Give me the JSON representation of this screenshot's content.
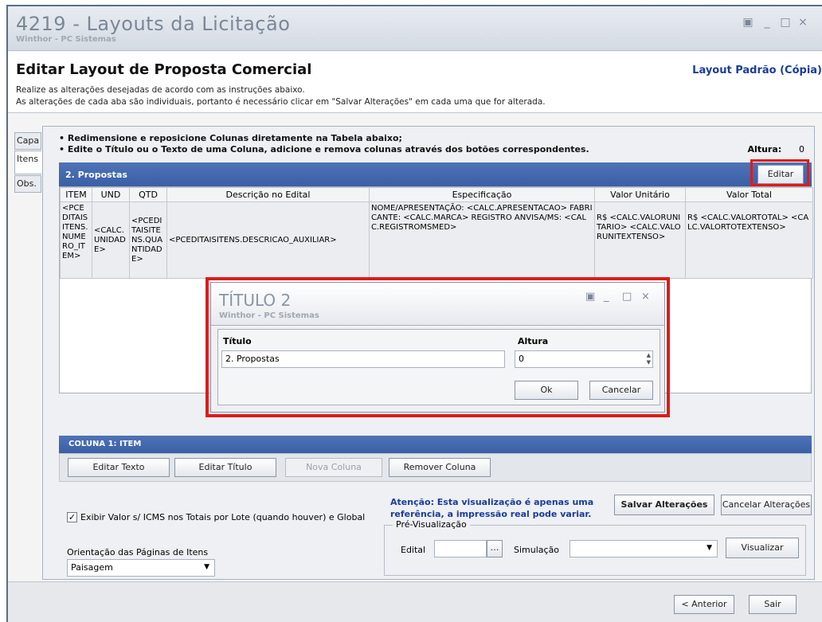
{
  "window": {
    "title": "4219 - Layouts da Licitação",
    "subtitle": "Winthor - PC Sistemas",
    "controls": [
      "▣",
      "_",
      "□",
      "×"
    ]
  },
  "header": {
    "title": "Editar Layout de Proposta Comercial",
    "layout_name": "Layout Padrão (Cópia)",
    "desc1": "Realize as alterações desejadas de acordo com as instruções abaixo.",
    "desc2": "As alterações de cada aba são individuais, portanto é necessário clicar em \"Salvar Alterações\" em cada uma que for alterada."
  },
  "sidetabs": [
    "Capa",
    "Itens",
    "Obs."
  ],
  "instructions": {
    "line1": "• Redimensione e reposicione Colunas diretamente na Tabela abaixo;",
    "line2": "• Edite o Título ou o Texto de uma Coluna, adicione e remova colunas  através dos botões correspondentes.",
    "altura_label": "Altura:",
    "altura_value": "0"
  },
  "section": {
    "title": "2. Propostas",
    "edit_button": "Editar"
  },
  "table": {
    "headers": [
      "ITEM",
      "UND",
      "QTD",
      "Descrição no Edital",
      "Especificação",
      "Valor Unitário",
      "Valor Total"
    ],
    "row": [
      "<PCEDITAISITENS.NUMERO_ITEM>",
      "<CALC.UNIDADE>",
      "<PCEDITAISITENS.QUANTIDADE>",
      "<PCEDITAISITENS.DESCRICAO_AUXILIAR>",
      "NOME/APRESENTAÇÃO: <CALC.APRESENTACAO> FABRICANTE: <CALC.MARCA> REGISTRO ANVISA/MS: <CALC.REGISTROMSMED>",
      "R$ <CALC.VALORUNITARIO> <CALC.VALORUNITEXTENSO>",
      "R$ <CALC.VALORTOTAL> <CALC.VALORTOTEXTENSO>"
    ]
  },
  "column_bar": "COLUNA 1: ITEM",
  "buttons": {
    "editar_texto": "Editar Texto",
    "editar_titulo": "Editar Título",
    "nova_coluna": "Nova Coluna",
    "remover_coluna": "Remover Coluna",
    "salvar": "Salvar Alterações",
    "cancelar_alteracoes": "Cancelar Alterações",
    "visualizar": "Visualizar",
    "anterior": "< Anterior",
    "sair": "Sair"
  },
  "checkbox": {
    "checked": true,
    "label": "Exibir Valor s/ ICMS nos Totais por Lote (quando houver) e Global"
  },
  "atencao": {
    "line1": "Atenção: Esta visualização é apenas uma",
    "line2": "referência, a impressão real pode variar."
  },
  "orientacao": {
    "label": "Orientação das Páginas de Itens",
    "value": "Paisagem"
  },
  "preview": {
    "legend": "Pré-Visualização",
    "edital_label": "Edital",
    "edital_value": "",
    "simulacao_label": "Simulação",
    "simulacao_value": ""
  },
  "modal": {
    "title": "TÍTULO 2",
    "subtitle": "Winthor - PC Sistemas",
    "titulo_label": "Título",
    "titulo_value": "2. Propostas",
    "altura_label": "Altura",
    "altura_value": "0",
    "ok": "Ok",
    "cancelar": "Cancelar"
  },
  "colors": {
    "section_bar": "#3a5fa6",
    "highlight": "#e01a1a",
    "link_blue": "#1a3c9c"
  }
}
